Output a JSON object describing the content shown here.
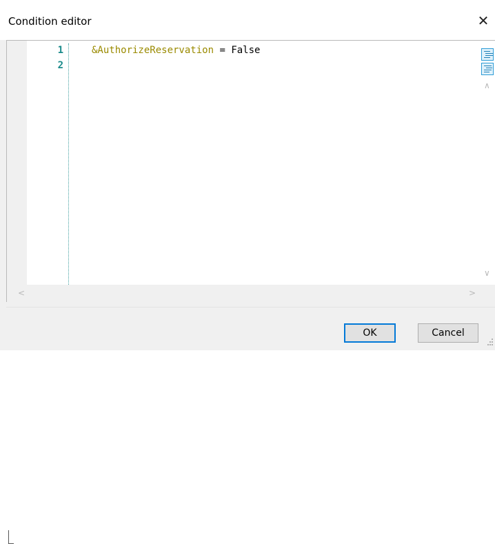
{
  "window": {
    "title": "Condition editor",
    "close_glyph": "✕"
  },
  "editor": {
    "line_numbers": [
      "1",
      "2"
    ],
    "code_line_1": {
      "variable": "&AuthorizeReservation",
      "operator": " = ",
      "value": "False"
    },
    "side_icons": [
      "comment-lines-icon",
      "uncomment-lines-icon"
    ]
  },
  "buttons": {
    "ok_label": "OK",
    "cancel_label": "Cancel"
  },
  "colors": {
    "line_number": "#1a8a8a",
    "variable": "#9a8a00",
    "default_button_border": "#0078d7"
  }
}
